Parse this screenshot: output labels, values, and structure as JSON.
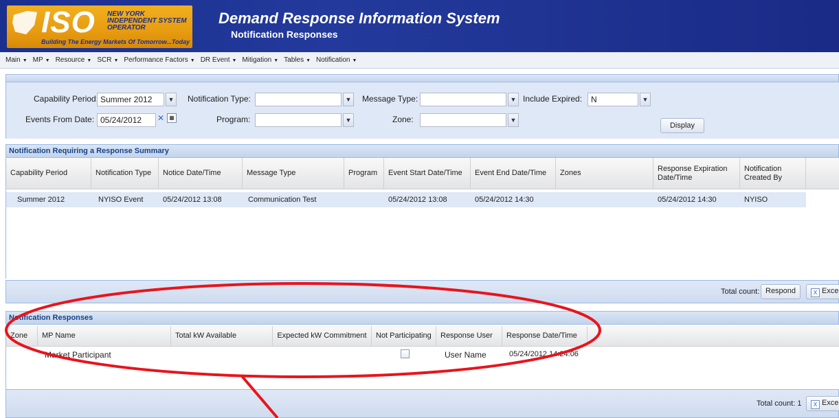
{
  "header": {
    "logo_text": "ISO",
    "logo_org": "NEW YORK INDEPENDENT SYSTEM OPERATOR",
    "logo_tagline": "Building The Energy Markets Of Tomorrow...Today",
    "app_title": "Demand Response Information System",
    "page_subtitle": "Notification Responses"
  },
  "menu": {
    "items": [
      {
        "label": "Main"
      },
      {
        "label": "MP"
      },
      {
        "label": "Resource"
      },
      {
        "label": "SCR"
      },
      {
        "label": "Performance Factors"
      },
      {
        "label": "DR Event"
      },
      {
        "label": "Mitigation"
      },
      {
        "label": "Tables"
      },
      {
        "label": "Notification"
      }
    ]
  },
  "filters": {
    "capability_period_label": "Capability Period:",
    "capability_period_value": "Summer 2012",
    "notification_type_label": "Notification Type:",
    "notification_type_value": "",
    "message_type_label": "Message Type:",
    "message_type_value": "",
    "include_expired_label": "Include Expired:",
    "include_expired_value": "N",
    "events_from_date_label": "Events From Date:",
    "events_from_date_value": "05/24/2012",
    "program_label": "Program:",
    "program_value": "",
    "zone_label": "Zone:",
    "zone_value": "",
    "display_button": "Display"
  },
  "summary": {
    "title": "Notification Requiring a Response Summary",
    "columns": [
      "Capability Period",
      "Notification Type",
      "Notice Date/Time",
      "Message Type",
      "Program",
      "Event Start Date/Time",
      "Event End Date/Time",
      "Zones",
      "Response Expiration Date/Time",
      "Notification Created By"
    ],
    "rows": [
      [
        "Summer 2012",
        "NYISO Event",
        "05/24/2012 13:08",
        "Communication Test",
        "",
        "05/24/2012 13:08",
        "05/24/2012 14:30",
        "",
        "05/24/2012 14:30",
        "NYISO"
      ]
    ],
    "total_count": "Total count: 1",
    "respond_button": "Respond",
    "excel_button": "Excel"
  },
  "responses": {
    "title": "Notification Responses",
    "columns": [
      "Zone",
      "MP Name",
      "Total kW Available",
      "Expected kW Commitment",
      "Not Participating",
      "Response User",
      "Response Date/Time"
    ],
    "rows": [
      {
        "zone": "",
        "mp_name": "Market Participant",
        "total_kw": "",
        "expected_kw": "",
        "not_participating": false,
        "response_user": "User Name",
        "response_datetime": "05/24/2012 14:24:06"
      }
    ],
    "total_count": "Total count: 1",
    "excel_button": "Excel"
  },
  "colors": {
    "header_bg": "#1b2f8e",
    "logo_gold": "#e89c10",
    "panel_title": "#15428b",
    "annotation": "#e8141c"
  }
}
